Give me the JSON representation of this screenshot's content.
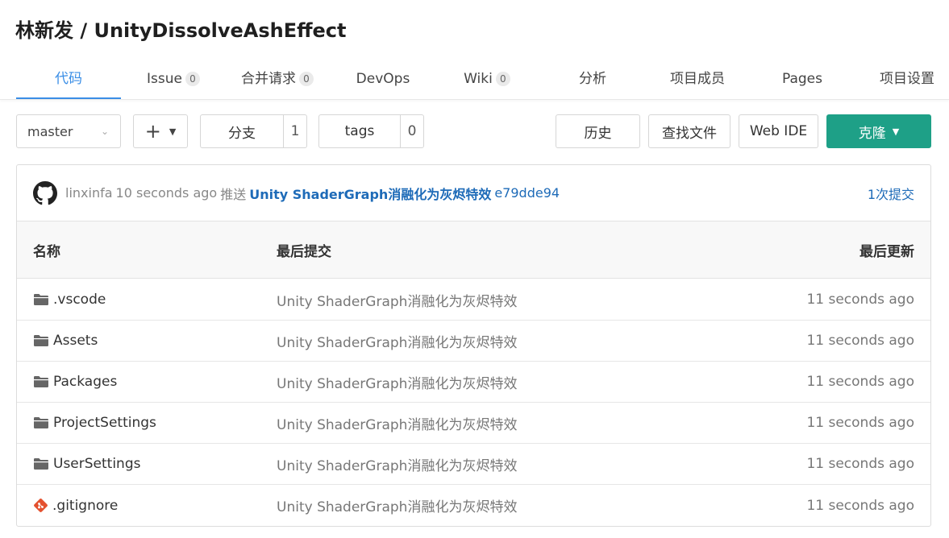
{
  "repo": {
    "title": "林新发 / UnityDissolveAshEffect"
  },
  "tabs": [
    {
      "label": "代码",
      "count": null,
      "active": true
    },
    {
      "label": "Issue",
      "count": "0"
    },
    {
      "label": "合并请求",
      "count": "0"
    },
    {
      "label": "DevOps",
      "count": null
    },
    {
      "label": "Wiki",
      "count": "0"
    },
    {
      "label": "分析",
      "count": null
    },
    {
      "label": "项目成员",
      "count": null
    },
    {
      "label": "Pages",
      "count": null
    },
    {
      "label": "项目设置",
      "count": null
    }
  ],
  "toolbar": {
    "branch_value": "master",
    "branches_label": "分支",
    "branches_count": "1",
    "tags_label": "tags",
    "tags_count": "0",
    "history_label": "历史",
    "find_file_label": "查找文件",
    "web_ide_label": "Web IDE",
    "clone_label": "克隆",
    "clone_color": "#1ea087"
  },
  "commit": {
    "author": "linxinfa",
    "time": "10 seconds ago",
    "action": "推送",
    "message": "Unity ShaderGraph消融化为灰烬特效",
    "hash": "e79dde94",
    "count_label": "1次提交",
    "link_color": "#1e6bb8"
  },
  "table": {
    "headers": {
      "name": "名称",
      "last_commit": "最后提交",
      "last_updated": "最后更新"
    },
    "rows": [
      {
        "icon": "folder-icon",
        "name": ".vscode",
        "commit": "Unity ShaderGraph消融化为灰烬特效",
        "updated": "11 seconds ago"
      },
      {
        "icon": "folder-icon",
        "name": "Assets",
        "commit": "Unity ShaderGraph消融化为灰烬特效",
        "updated": "11 seconds ago"
      },
      {
        "icon": "folder-icon",
        "name": "Packages",
        "commit": "Unity ShaderGraph消融化为灰烬特效",
        "updated": "11 seconds ago"
      },
      {
        "icon": "folder-icon",
        "name": "ProjectSettings",
        "commit": "Unity ShaderGraph消融化为灰烬特效",
        "updated": "11 seconds ago"
      },
      {
        "icon": "folder-icon",
        "name": "UserSettings",
        "commit": "Unity ShaderGraph消融化为灰烬特效",
        "updated": "11 seconds ago"
      },
      {
        "icon": "git-icon",
        "name": ".gitignore",
        "commit": "Unity ShaderGraph消融化为灰烬特效",
        "updated": "11 seconds ago"
      }
    ]
  }
}
